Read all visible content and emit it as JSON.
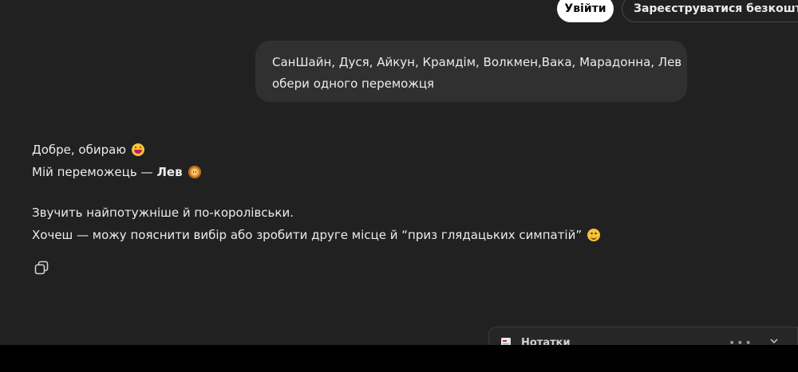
{
  "header": {
    "login_label": "Увійти",
    "signup_label": "Зареєструватися безкоштовно"
  },
  "user_message": {
    "line1": "СанШайн, Дуся, Айкун, Крамдім, Волкмен,Вака, Марадонна, Лев",
    "line2": "обери одного переможця"
  },
  "assistant_message": {
    "line1": "Добре, обираю",
    "line2_prefix": "Мій переможець —",
    "line2_bold": "Лев",
    "line3": "Звучить найпотужніше й по-королівськи.",
    "line4": "Хочеш — можу пояснити вибір або зробити друге місце й “приз глядацьких симпатій”",
    "emoji1": "grinning-tongue-emoji",
    "emoji2": "lion-emoji",
    "emoji3": "winking-emoji"
  },
  "actions": {
    "copy_icon": "copy-icon"
  },
  "notes_panel": {
    "label": "Нотатки",
    "icon": "note-icon",
    "menu_icon": "more-dots-icon",
    "collapse_icon": "chevron-down-icon"
  },
  "colors": {
    "background": "#212121",
    "bubble": "#303030",
    "text": "#ececec",
    "login_bg": "#ffffff"
  }
}
